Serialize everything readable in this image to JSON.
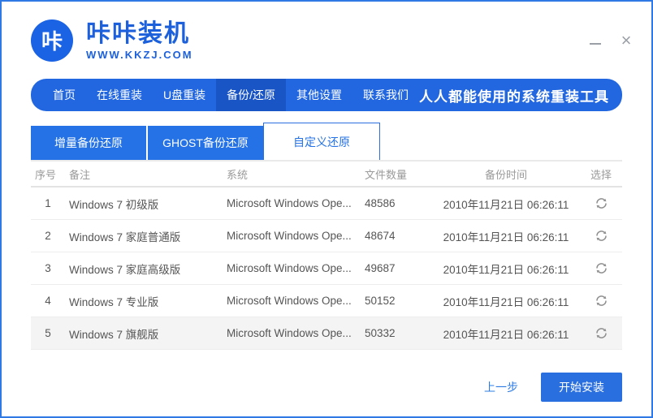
{
  "window": {
    "close_glyph": "×"
  },
  "header": {
    "logo_badge": "咔",
    "logo_title": "咔咔装机",
    "logo_sub": "WWW.KKZJ.COM"
  },
  "nav": {
    "items": [
      {
        "label": "首页",
        "active": false
      },
      {
        "label": "在线重装",
        "active": false
      },
      {
        "label": "U盘重装",
        "active": false
      },
      {
        "label": "备份/还原",
        "active": true
      },
      {
        "label": "其他设置",
        "active": false
      },
      {
        "label": "联系我们",
        "active": false
      }
    ],
    "slogan": "人人都能使用的系统重装工具"
  },
  "tabs": [
    {
      "label": "增量备份还原",
      "active": false
    },
    {
      "label": "GHOST备份还原",
      "active": false
    },
    {
      "label": "自定义还原",
      "active": true
    }
  ],
  "table": {
    "headers": [
      "序号",
      "备注",
      "系统",
      "文件数量",
      "备份时间",
      "选择"
    ],
    "rows": [
      {
        "no": "1",
        "remark": "Windows 7 初级版",
        "system": "Microsoft Windows Ope...",
        "files": "48586",
        "time": "2010年11月21日 06:26:11"
      },
      {
        "no": "2",
        "remark": "Windows 7 家庭普通版",
        "system": "Microsoft Windows Ope...",
        "files": "48674",
        "time": "2010年11月21日 06:26:11"
      },
      {
        "no": "3",
        "remark": "Windows 7 家庭高级版",
        "system": "Microsoft Windows Ope...",
        "files": "49687",
        "time": "2010年11月21日 06:26:11"
      },
      {
        "no": "4",
        "remark": "Windows 7 专业版",
        "system": "Microsoft Windows Ope...",
        "files": "50152",
        "time": "2010年11月21日 06:26:11"
      },
      {
        "no": "5",
        "remark": "Windows 7 旗舰版",
        "system": "Microsoft Windows Ope...",
        "files": "50332",
        "time": "2010年11月21日 06:26:11"
      }
    ]
  },
  "footer": {
    "back_label": "上一步",
    "install_label": "开始安装"
  },
  "icons": {
    "select_icon": "circular-sync-arrows",
    "minimize_icon": "horizontal-bar",
    "close_icon": "x-mark"
  },
  "colors": {
    "primary_blue": "#2267e0",
    "nav_active_blue": "#1a55c6",
    "tab_blue": "#2472e6",
    "logo_blue": "#1c60dc",
    "link_blue": "#2e7ce2",
    "button_blue": "#2a6fe0",
    "window_border": "#2e79e3",
    "icon_gray": "#8f8f8f"
  }
}
